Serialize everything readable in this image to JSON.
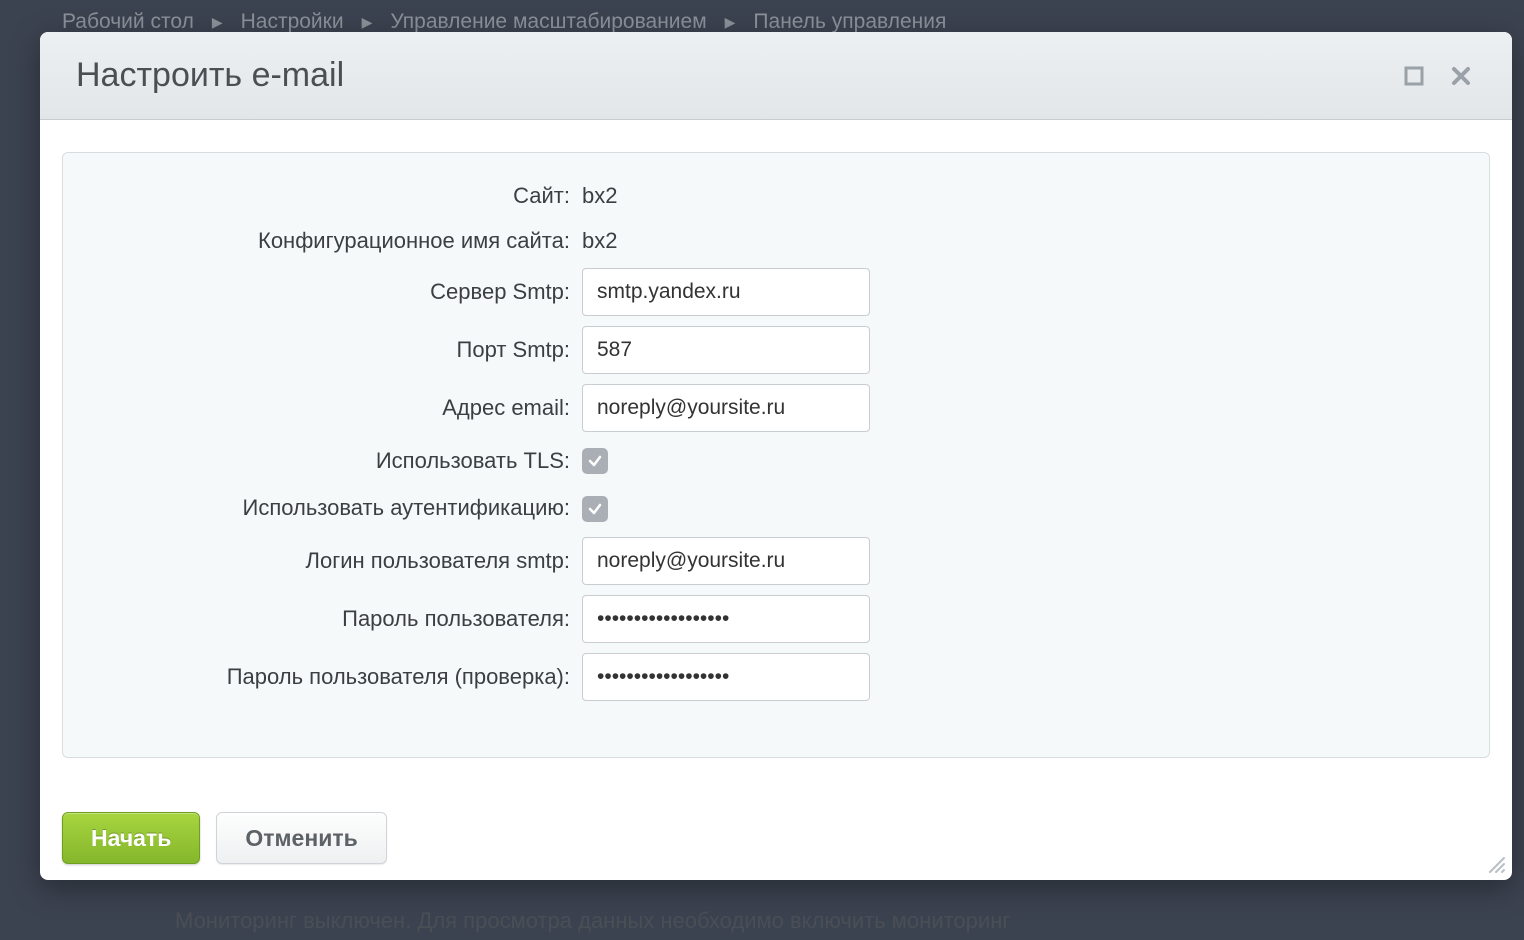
{
  "breadcrumbs": {
    "items": [
      "Рабочий стол",
      "Настройки",
      "Управление масштабированием",
      "Панель управления"
    ]
  },
  "bottom_hint": "Мониторинг выключен. Для просмотра данных необходимо включить мониторинг",
  "modal": {
    "title": "Настроить e-mail",
    "submit_label": "Начать",
    "cancel_label": "Отменить"
  },
  "form": {
    "site": {
      "label": "Сайт:",
      "value": "bx2"
    },
    "config_name": {
      "label": "Конфигурационное имя сайта:",
      "value": "bx2"
    },
    "smtp_server": {
      "label": "Сервер Smtp:",
      "value": "smtp.yandex.ru"
    },
    "smtp_port": {
      "label": "Порт Smtp:",
      "value": "587"
    },
    "email": {
      "label": "Адрес email:",
      "value": "noreply@yoursite.ru"
    },
    "use_tls": {
      "label": "Использовать TLS:",
      "checked": true
    },
    "use_auth": {
      "label": "Использовать аутентификацию:",
      "checked": true
    },
    "smtp_login": {
      "label": "Логин пользователя smtp:",
      "value": "noreply@yoursite.ru"
    },
    "password": {
      "label": "Пароль пользователя:",
      "value": "••••••••••••••••••"
    },
    "password_confirm": {
      "label": "Пароль пользователя (проверка):",
      "value": "••••••••••••••••••"
    }
  }
}
